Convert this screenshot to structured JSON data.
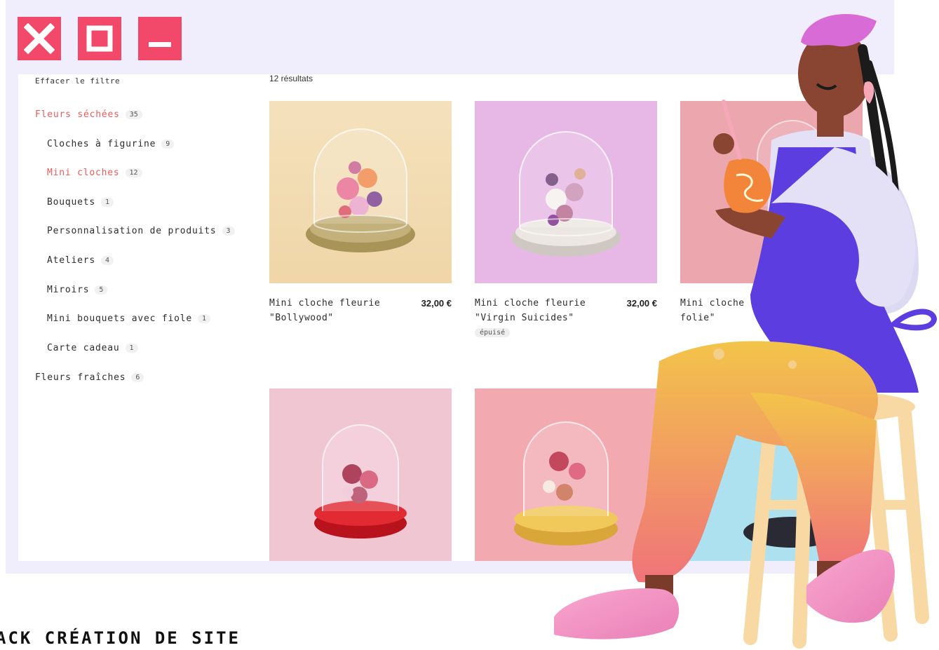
{
  "filter": {
    "clear_label": "Effacer le filtre"
  },
  "categories": [
    {
      "label": "Fleurs séchées",
      "count": "35",
      "active": true,
      "level": 0
    },
    {
      "label": "Cloches à figurine",
      "count": "9",
      "active": false,
      "level": 1
    },
    {
      "label": "Mini cloches",
      "count": "12",
      "active": true,
      "level": 1
    },
    {
      "label": "Bouquets",
      "count": "1",
      "active": false,
      "level": 1
    },
    {
      "label": "Personnalisation de produits",
      "count": "3",
      "active": false,
      "level": 1
    },
    {
      "label": "Ateliers",
      "count": "4",
      "active": false,
      "level": 1
    },
    {
      "label": "Miroirs",
      "count": "5",
      "active": false,
      "level": 1
    },
    {
      "label": "Mini bouquets avec fiole",
      "count": "1",
      "active": false,
      "level": 1
    },
    {
      "label": "Carte cadeau",
      "count": "1",
      "active": false,
      "level": 1
    },
    {
      "label": "Fleurs fraîches",
      "count": "6",
      "active": false,
      "level": 0
    }
  ],
  "results": {
    "count_label": "12 résultats"
  },
  "products": [
    {
      "title": "Mini cloche fleurie \"Bollywood\"",
      "price": "32,00 €",
      "badge": ""
    },
    {
      "title": "Mini cloche fleurie \"Virgin Suicides\"",
      "price": "32,00 €",
      "badge": "épuisé"
    },
    {
      "title": "Mini cloche fleurie folie\"",
      "price": "",
      "badge": ""
    },
    {
      "title": "",
      "price": "",
      "badge": ""
    },
    {
      "title": "",
      "price": "",
      "badge": ""
    },
    {
      "title": "",
      "price": "",
      "badge": ""
    }
  ],
  "caption": {
    "text": "ACK CRÉATION DE SITE"
  },
  "colors": {
    "window_bg": "#f0eefc",
    "window_buttons": "#f2486a",
    "active_category": "#e85c5c",
    "apron": "#5b3de0",
    "trousers": "#f2a94a"
  },
  "icons": {
    "close": "close-icon",
    "maximize": "maximize-icon",
    "minimize": "minimize-icon"
  }
}
